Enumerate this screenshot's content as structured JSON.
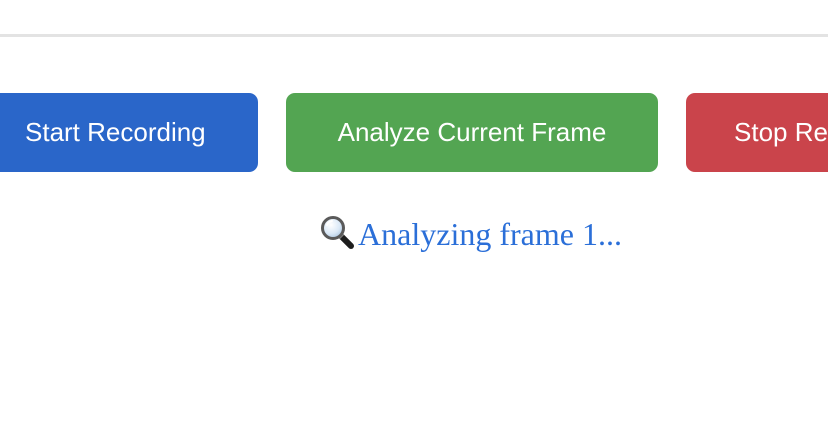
{
  "controls": {
    "start_label": "Start Recording",
    "analyze_label": "Analyze Current Frame",
    "stop_label": "Stop Recording"
  },
  "status": {
    "icon": "magnifying-glass-icon",
    "text": "Analyzing frame 1..."
  },
  "colors": {
    "start_button": "#2a66c9",
    "analyze_button": "#53a552",
    "stop_button": "#ca444b",
    "status_text": "#2b6fd8",
    "divider": "#e3e3e3"
  }
}
